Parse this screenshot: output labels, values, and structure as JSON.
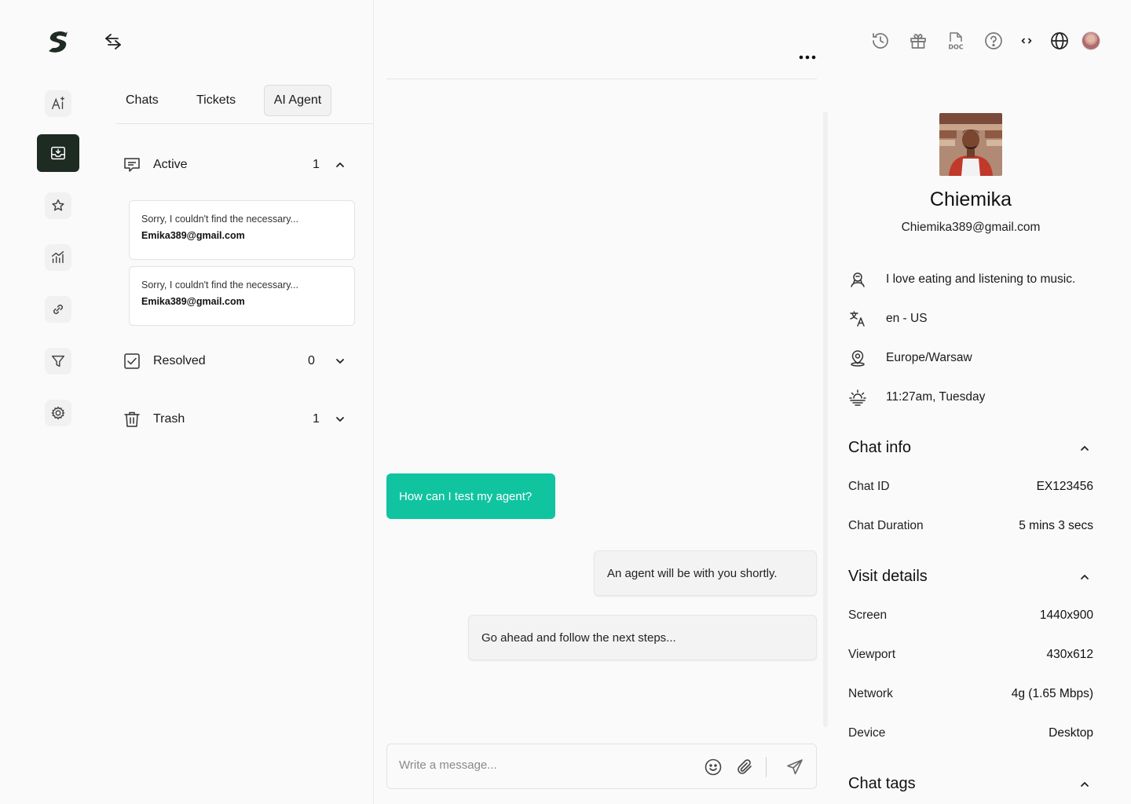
{
  "nav": {
    "items": [
      "ai-assist",
      "inbox",
      "favorites",
      "analytics",
      "integrations",
      "filters",
      "settings"
    ],
    "active": "inbox"
  },
  "tabs": [
    {
      "label": "Chats"
    },
    {
      "label": "Tickets"
    },
    {
      "label": "AI Agent",
      "selected": true
    }
  ],
  "groups": {
    "active": {
      "label": "Active",
      "count": "1"
    },
    "resolved": {
      "label": "Resolved",
      "count": "0"
    },
    "trash": {
      "label": "Trash",
      "count": "1"
    }
  },
  "chats": [
    {
      "preview": "Sorry, I couldn't find the necessary...",
      "email": "Emika389@gmail.com"
    },
    {
      "preview": "Sorry, I couldn't find the necessary...",
      "email": "Emika389@gmail.com"
    }
  ],
  "messages": [
    {
      "from": "user",
      "text": "How can I test my agent?"
    },
    {
      "from": "agent",
      "text": "An agent will be with you shortly."
    },
    {
      "from": "agent",
      "text": "Go ahead and follow the next steps..."
    }
  ],
  "composer": {
    "placeholder": "Write a message..."
  },
  "toolbar": [
    "history-icon",
    "gift-icon",
    "doc-icon",
    "help-icon",
    "code-icon",
    "globe-icon",
    "user-avatar"
  ],
  "profile": {
    "name": "Chiemika",
    "email": "Chiemika389@gmail.com",
    "bio": "I love eating and listening to music.",
    "language": "en - US",
    "timezone": "Europe/Warsaw",
    "local_time": "11:27am, Tuesday"
  },
  "chat_info": {
    "title": "Chat info",
    "chat_id_label": "Chat ID",
    "chat_id": "EX123456",
    "duration_label": "Chat Duration",
    "duration": "5 mins 3 secs"
  },
  "visit_details": {
    "title": "Visit details",
    "screen_label": "Screen",
    "screen": "1440x900",
    "viewport_label": "Viewport",
    "viewport": "430x612",
    "network_label": "Network",
    "network": "4g (1.65 Mbps)",
    "device_label": "Device",
    "device": "Desktop"
  },
  "chat_tags": {
    "title": "Chat tags"
  },
  "colors": {
    "accent": "#10c4a0",
    "nav_active": "#1e2b23",
    "background": "#fafafa"
  }
}
